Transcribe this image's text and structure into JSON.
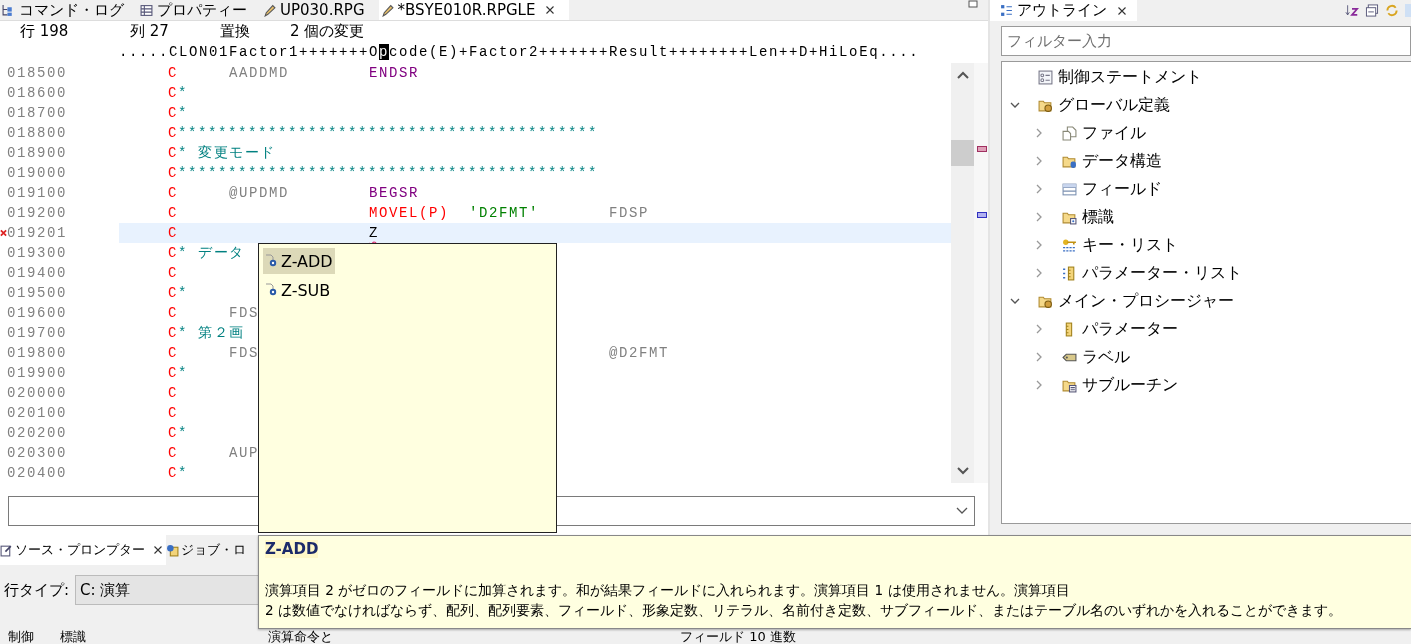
{
  "editor_tabs": [
    {
      "label": "コマンド・ログ",
      "kind": "log",
      "selected": false,
      "closable": false
    },
    {
      "label": "プロパティー",
      "kind": "table",
      "selected": false,
      "closable": false
    },
    {
      "label": "UP030.RPG",
      "kind": "pencil",
      "selected": false,
      "closable": false
    },
    {
      "label": "*BSYE010R.RPGLE",
      "kind": "pencil",
      "selected": true,
      "closable": true
    }
  ],
  "status_line": {
    "line": "行 198",
    "column": "列 27",
    "mode": "置換",
    "changes": "2 個の変更"
  },
  "ruler": {
    "before": ".....CLON01Factor1+++++++O",
    "cursor": "p",
    "after": "code(E)+Factor2+++++++Result++++++++Len++D+HiLoEq...."
  },
  "code_rows": [
    {
      "number": "018500",
      "spec": "C",
      "kind": "calc",
      "factor1": "AADDMD",
      "opcode": {
        "text": "ENDSR",
        "color": "#800080"
      },
      "selected": false,
      "error": false
    },
    {
      "number": "018600",
      "spec": "C",
      "kind": "comment",
      "comment": "*",
      "selected": false,
      "error": false
    },
    {
      "number": "018700",
      "spec": "C",
      "kind": "comment",
      "comment": "*",
      "selected": false,
      "error": false
    },
    {
      "number": "018800",
      "spec": "C",
      "kind": "comment",
      "comment": "******************************************",
      "selected": false,
      "error": false
    },
    {
      "number": "018900",
      "spec": "C",
      "kind": "comment",
      "comment": "* 変更モード",
      "selected": false,
      "error": false
    },
    {
      "number": "019000",
      "spec": "C",
      "kind": "comment",
      "comment": "******************************************",
      "selected": false,
      "error": false
    },
    {
      "number": "019100",
      "spec": "C",
      "kind": "calc",
      "factor1": "@UPDMD",
      "opcode": {
        "text": "BEGSR",
        "color": "#800080"
      },
      "selected": false,
      "error": false
    },
    {
      "number": "019200",
      "spec": "C",
      "kind": "calc",
      "opcode": {
        "text": "MOVEL(P)",
        "color": "#ff0000"
      },
      "factor2": "'D2FMT'",
      "result": "FDSP",
      "selected": false,
      "error": false
    },
    {
      "number": "019201",
      "spec": "C",
      "kind": "calc",
      "opcode": {
        "text": "Z",
        "color": "#000000"
      },
      "selected": true,
      "error": true
    },
    {
      "number": "019300",
      "spec": "C",
      "kind": "comment",
      "comment": "* データ",
      "selected": false,
      "error": false
    },
    {
      "number": "019400",
      "spec": "C",
      "kind": "calc",
      "selected": false,
      "error": false
    },
    {
      "number": "019500",
      "spec": "C",
      "kind": "comment",
      "comment": "*",
      "selected": false,
      "error": false
    },
    {
      "number": "019600",
      "spec": "C",
      "kind": "calc",
      "factor1": "FDS",
      "selected": false,
      "error": false
    },
    {
      "number": "019700",
      "spec": "C",
      "kind": "comment",
      "comment": "* 第２画",
      "selected": false,
      "error": false
    },
    {
      "number": "019800",
      "spec": "C",
      "kind": "calc",
      "factor1": "FDS",
      "result": "@D2FMT",
      "selected": false,
      "error": false
    },
    {
      "number": "019900",
      "spec": "C",
      "kind": "comment",
      "comment": "*",
      "selected": false,
      "error": false
    },
    {
      "number": "020000",
      "spec": "C",
      "kind": "calc",
      "selected": false,
      "error": false
    },
    {
      "number": "020100",
      "spec": "C",
      "kind": "calc",
      "selected": false,
      "error": false
    },
    {
      "number": "020200",
      "spec": "C",
      "kind": "comment",
      "comment": "*",
      "selected": false,
      "error": false
    },
    {
      "number": "020300",
      "spec": "C",
      "kind": "calc",
      "factor1": "AUP",
      "selected": false,
      "error": false
    },
    {
      "number": "020400",
      "spec": "C",
      "kind": "comment",
      "comment": "*",
      "selected": false,
      "error": false
    }
  ],
  "outline": {
    "tab": {
      "label": "アウトライン",
      "selected": true,
      "closable": true
    },
    "filter": {
      "placeholder": "フィルター入力"
    },
    "items": [
      {
        "label": "制御ステートメント",
        "kind": "list"
      },
      {
        "label": "グローバル定義",
        "kind": "folder-gear",
        "expanded": true,
        "children": [
          {
            "label": "ファイル",
            "kind": "file",
            "expanded": false
          },
          {
            "label": "データ構造",
            "kind": "folder-db",
            "expanded": false
          },
          {
            "label": "フィールド",
            "kind": "field",
            "expanded": false
          },
          {
            "label": "標識",
            "kind": "folder-dot",
            "expanded": false
          },
          {
            "label": "キー・リスト",
            "kind": "key",
            "expanded": false
          },
          {
            "label": "パラメーター・リスト",
            "kind": "param-list",
            "expanded": false
          }
        ]
      },
      {
        "label": "メイン・プロシージャー",
        "kind": "folder-gear",
        "expanded": true,
        "children": [
          {
            "label": "パラメーター",
            "kind": "param",
            "expanded": false
          },
          {
            "label": "ラベル",
            "kind": "tag",
            "expanded": false
          },
          {
            "label": "サブルーチン",
            "kind": "folder-doc",
            "expanded": false
          }
        ]
      }
    ]
  },
  "bottom_panel": {
    "tabs": [
      {
        "label": "ソース・プロンプター",
        "kind": "prompter",
        "selected": true,
        "closable": true
      },
      {
        "label": "ジョブ・ロ",
        "kind": "gear-doc",
        "selected": false,
        "closable": false
      }
    ],
    "line_type": {
      "label": "行タイプ:",
      "value": "C: 演算"
    },
    "columns": [
      "制御",
      "標識",
      "演算命令と",
      "フィールド 10 進数"
    ]
  },
  "completion": {
    "items": [
      {
        "label": "Z-ADD",
        "selected": true
      },
      {
        "label": "Z-SUB",
        "selected": false
      }
    ]
  },
  "help": {
    "title": "Z-ADD",
    "description": "演算項目 2 がゼロのフィールドに加算されます。和が結果フィールドに入れられます。演算項目 1 は使用されません。演算項目\n 2 は数値でなければならず、配列、配列要素、フィールド、形象定数、リテラル、名前付き定数、サブフィールド、またはテーブル名のいずれかを入れることができます。"
  }
}
